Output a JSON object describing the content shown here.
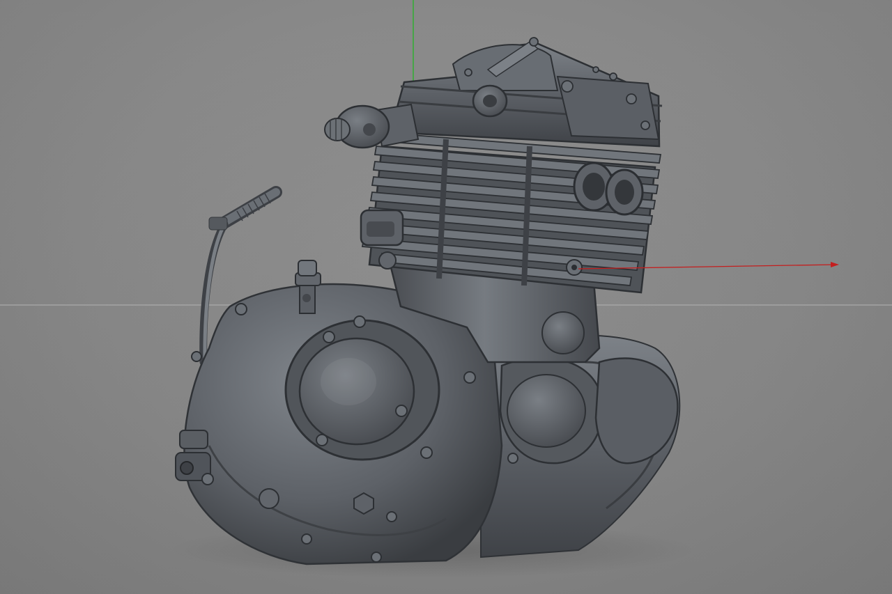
{
  "viewport": {
    "background_color": "#878787",
    "horizon_line_color": "#b4b4b4",
    "object_base_color": "#5a5e63",
    "object_highlight_color": "#8a8f95",
    "object_shadow_color": "#2f3236"
  },
  "axes": {
    "x_axis_color": "#c41e1e",
    "y_axis_color": "#22b422"
  },
  "icons": {
    "model": "engine-model-icon"
  }
}
